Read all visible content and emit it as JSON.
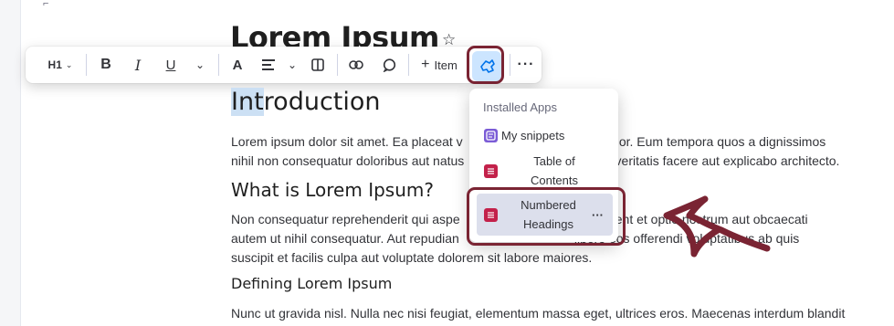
{
  "doc": {
    "title": "Lorem Ipsum",
    "h1": "Introduction",
    "h1_selected": "Int",
    "h1_rest": "roduction",
    "para1": "Lorem ipsum dolor sit amet. Ea placeat vel dolor quis aut fugit voluptatem et eligendi voluta dolor. Eum tempora quos a dignissimos nihil non consequatur doloribus aut natus illum aut internos blanditiis qui voluptatibus ut veritatis facere aut explicabo architecto.",
    "para1_line1": "Lorem ipsum dolor sit amet. Ea placeat v",
    "para1_line1b": "luta dolor. Eum tempora quos a dignissimos",
    "para1_line2": "nihil non consequatur doloribus aut natus",
    "para1_line2b": "us ut veritatis facere aut explicabo architecto.",
    "h2": "What is Lorem Ipsum?",
    "para2_line1": "Non consequatur reprehenderit qui aspe",
    "para2_line1b": "provident et optio nostrum aut obcaecati",
    "para2_line2": "autem ut nihil consequatur. Aut repudian",
    "para2_line2b": "libero eos offerendi voluptatibus ab quis",
    "para2_line3": "suscipit et facilis culpa aut voluptate dolorem sit labore maiores.",
    "h3": "Defining Lorem Ipsum",
    "para3_line1": "Nunc ut gravida nisl. Nulla nec nisi feugiat, elementum massa eget, ultrices eros. Maecenas interdum blandit"
  },
  "toolbar": {
    "heading_label": "H1",
    "add_label": "Item",
    "add_plus": "+"
  },
  "apps_menu": {
    "header": "Installed Apps",
    "items": [
      {
        "label": "My snippets",
        "icon": "snippets-icon",
        "color": "#7b5cd6"
      },
      {
        "label": "Table of Contents",
        "icon": "table-of-contents-icon",
        "color": "#c3214a"
      },
      {
        "label": "Numbered Headings",
        "icon": "numbered-headings-icon",
        "color": "#c3214a"
      }
    ],
    "more": "···"
  },
  "colors": {
    "highlight": "#7a2433",
    "active_bg": "#cce5ff",
    "accent": "#0073ea"
  }
}
